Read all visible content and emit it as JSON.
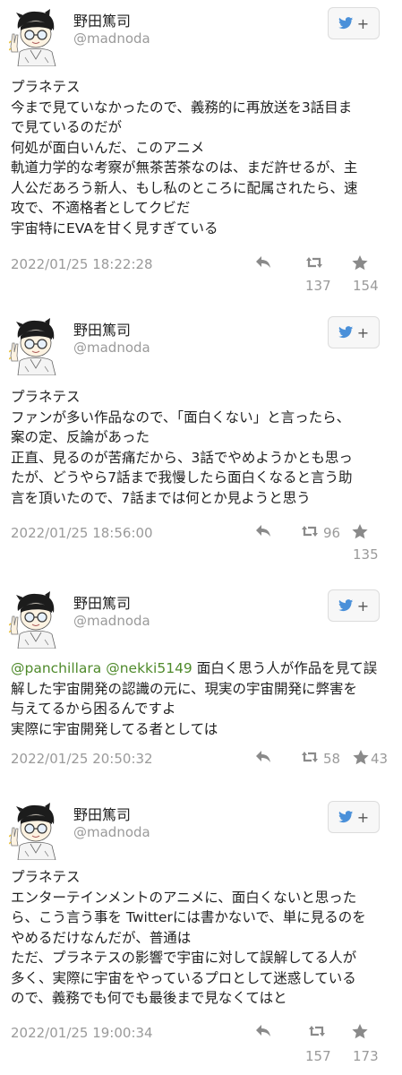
{
  "follow_label": "+",
  "colors": {
    "mention": "#4f8a2b",
    "muted": "#9a9a9a",
    "bird": "#4a90d9"
  },
  "tweets": [
    {
      "name": "野田篤司",
      "handle": "@madnoda",
      "lines": [
        "プラネテス",
        "今まで見ていなかったので、義務的に再放送を3話目ま",
        "で見ているのだが",
        "何処が面白いんだ、このアニメ",
        "軌道力学的な考察が無茶苦茶なのは、まだ許せるが、主",
        "人公だあろう新人、もし私のところに配属されたら、速",
        "攻で、不適格者としてクビだ",
        "宇宙特にEVAを甘く見すぎている"
      ],
      "time": "2022/01/25 18:22:28",
      "retweets": "137",
      "likes": "154"
    },
    {
      "name": "野田篤司",
      "handle": "@madnoda",
      "lines": [
        "プラネテス",
        "ファンが多い作品なので、「面白くない」と言ったら、",
        "案の定、反論があった",
        "正直、見るのが苦痛だから、3話でやめようかとも思っ",
        "たが、どうやら7話まで我慢したら面白くなると言う助",
        "言を頂いたので、7話までは何とか見ようと思う"
      ],
      "time": "2022/01/25 18:56:00",
      "retweets": "96",
      "likes": "135"
    },
    {
      "name": "野田篤司",
      "handle": "@madnoda",
      "mentions": "@panchillara @nekki5149",
      "first_line_rest": " 面白く思う人が作品を見て誤",
      "lines": [
        "解した宇宙開発の認識の元に、現実の宇宙開発に弊害を",
        "与えてるから困るんですよ",
        "実際に宇宙開発してる者としては"
      ],
      "time": "2022/01/25 20:50:32",
      "retweets": "58",
      "likes": "43"
    },
    {
      "name": "野田篤司",
      "handle": "@madnoda",
      "lines": [
        "プラネテス",
        "エンターテインメントのアニメに、面白くないと思った",
        "ら、こう言う事を Twitterには書かないで、単に見るのを",
        "やめるだけなんだが、普通は",
        "ただ、プラネテスの影響で宇宙に対して誤解してる人が",
        "多く、実際に宇宙をやっているプロとして迷惑している",
        "ので、義務でも何でも最後まで見なくてはと"
      ],
      "time": "2022/01/25 19:00:34",
      "retweets": "157",
      "likes": "173"
    }
  ]
}
